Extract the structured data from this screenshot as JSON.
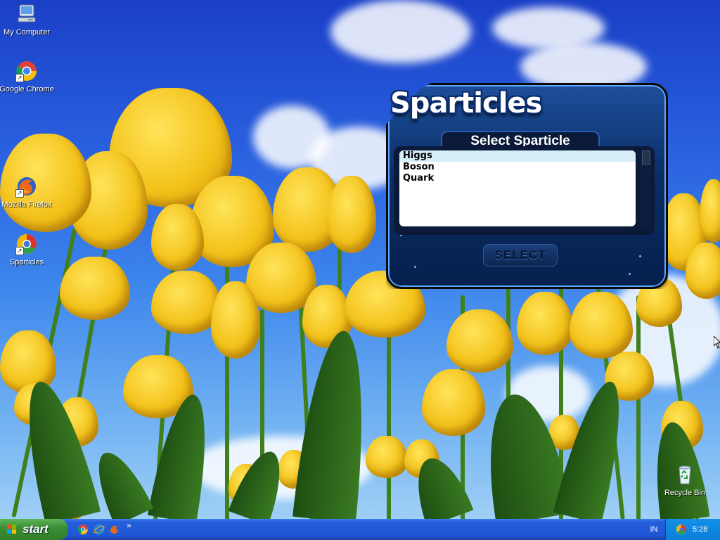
{
  "desktop": {
    "icons": [
      {
        "label": "My Computer",
        "icon": "my-computer-icon"
      },
      {
        "label": "Google Chrome",
        "icon": "chrome-icon"
      },
      {
        "label": "Mozilla Firefox",
        "icon": "firefox-icon"
      },
      {
        "label": "Sparticles",
        "icon": "sparticles-icon"
      },
      {
        "label": "Recycle Bin",
        "icon": "recycle-bin-icon"
      }
    ]
  },
  "app": {
    "logo": "Sparticles",
    "heading": "Select Sparticle",
    "list": {
      "items": [
        "Higgs",
        "Boson",
        "Quark"
      ],
      "selected": "Higgs"
    },
    "select_button": "SELECT"
  },
  "taskbar": {
    "start_label": "start",
    "quick_launch": [
      "chrome-icon",
      "internet-explorer-icon",
      "firefox-icon"
    ],
    "chevron": "»",
    "language": "IN",
    "clock": "5:28"
  },
  "colors": {
    "taskbar_blue": "#245edb",
    "start_green": "#3c8f34",
    "tray_blue": "#0c7fd9",
    "app_frame_blue": "#0b2e66",
    "list_selection": "#d6eef8"
  }
}
